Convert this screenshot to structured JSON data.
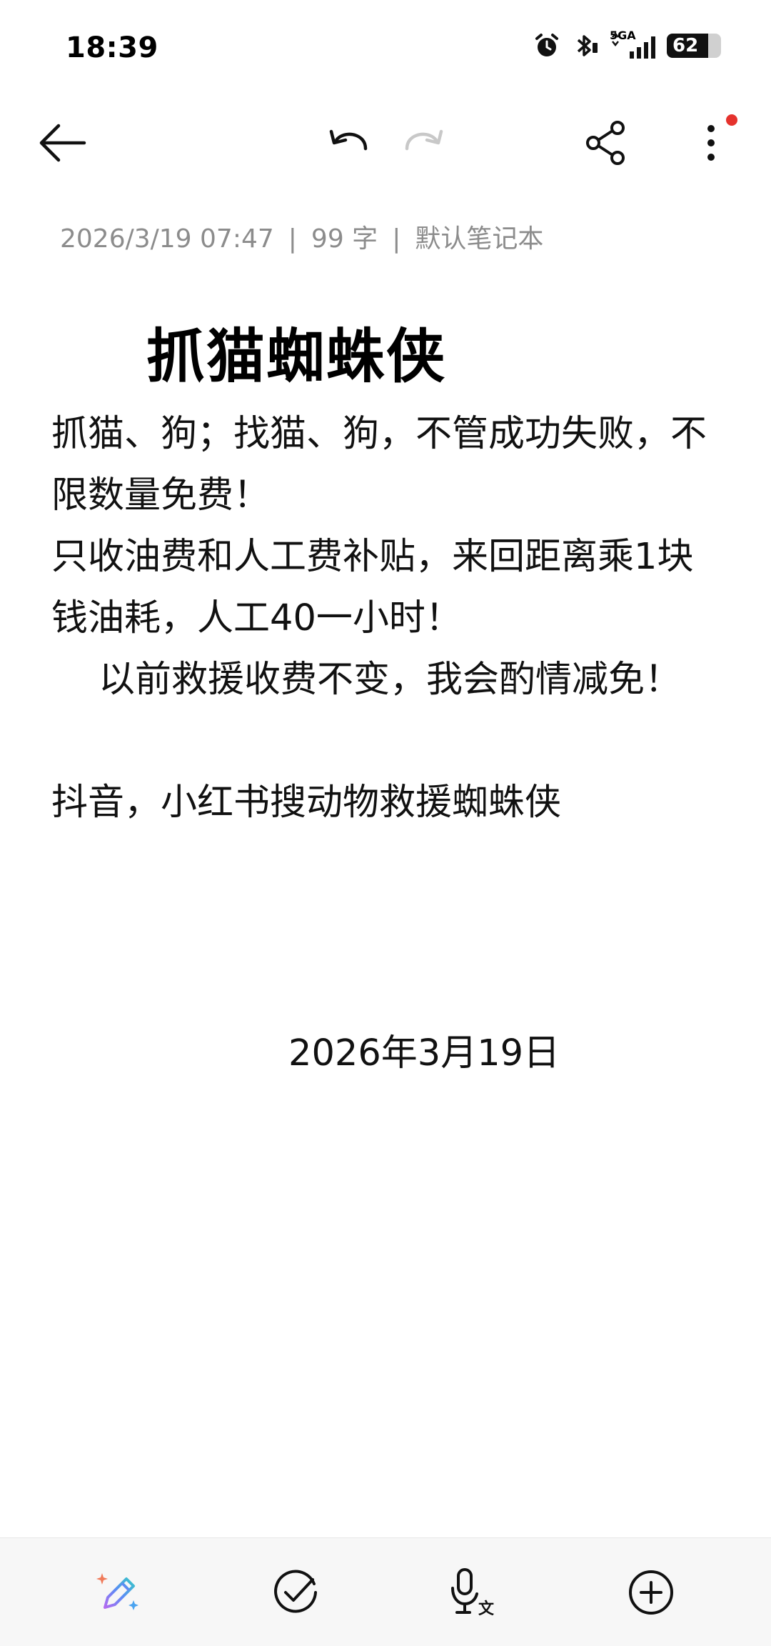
{
  "status_bar": {
    "time": "18:39",
    "network_label": "5GA",
    "battery_level": "62",
    "icons": [
      "alarm-icon",
      "bluetooth-icon",
      "signal-icon",
      "battery-icon"
    ]
  },
  "toolbar": {
    "icons": [
      "back-arrow-icon",
      "undo-icon",
      "redo-icon",
      "share-icon",
      "more-icon"
    ],
    "notification_dot_color": "#e5322d"
  },
  "note": {
    "meta": {
      "datetime": "2026/3/19 07:47",
      "word_count": "99 字",
      "notebook": "默认笔记本"
    },
    "title": "抓猫蜘蛛侠",
    "paragraphs": [
      "抓猫、狗；找猫、狗，不管成功失败，不限数量免费！",
      "只收油费和人工费补贴，来回距离乘1块钱油耗，人工40一小时！",
      "以前救援收费不变，我会酌情减免！",
      "抖音，小红书搜动物救援蜘蛛侠"
    ],
    "date": "2026年3月19日"
  },
  "bottom_bar": {
    "icons": [
      "ai-pen-icon",
      "checklist-icon",
      "voice-transcribe-icon",
      "add-icon"
    ]
  }
}
